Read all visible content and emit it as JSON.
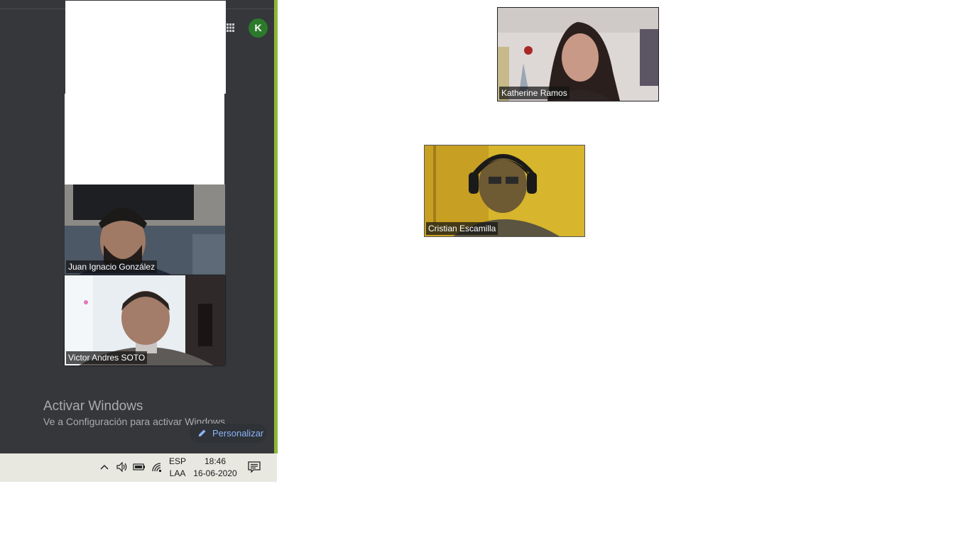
{
  "meeting": {
    "avatar_initial": "K",
    "participants": [
      {
        "name": "Juan Ignacio González",
        "active_speaker": true
      },
      {
        "name": "Victor Andres SOTO",
        "active_speaker": false
      },
      {
        "name": "Katherine Ramos",
        "active_speaker": false
      },
      {
        "name": "Cristian Escamilla",
        "active_speaker": false
      }
    ]
  },
  "watermark": {
    "title": "Activar Windows",
    "subtitle": "Ve a Configuración para activar Windows."
  },
  "customize": {
    "label": "Personalizar"
  },
  "taskbar": {
    "language_line1": "ESP",
    "language_line2": "LAA",
    "time": "18:46",
    "date": "16-06-2020"
  },
  "colors": {
    "panel_bg": "#35373b",
    "accent_border": "#8cb83a",
    "avatar_bg": "#2b7a2b",
    "link_blue": "#8ab4f8",
    "taskbar_bg": "#e8e8e0"
  },
  "icons": [
    "apps-grid-icon",
    "pencil-icon",
    "chevron-up-icon",
    "volume-icon",
    "battery-icon",
    "wifi-icon",
    "notification-icon"
  ]
}
